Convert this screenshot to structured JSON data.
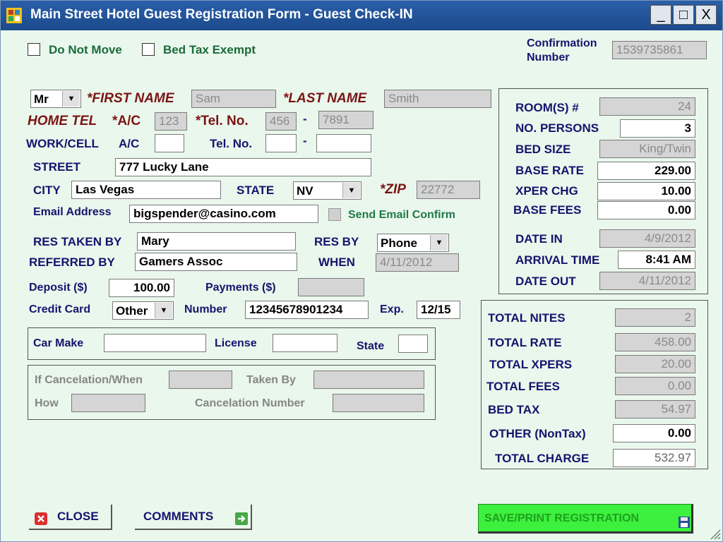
{
  "window": {
    "title": "Main Street Hotel Guest Registration Form - Guest Check-IN",
    "minimize": "_",
    "maximize": "□",
    "close": "X"
  },
  "top": {
    "do_not_move": "Do Not Move",
    "bed_tax_exempt": "Bed Tax Exempt",
    "confirmation_label_1": "Confirmation",
    "confirmation_label_2": "Number",
    "confirmation_value": "1539735861"
  },
  "guest": {
    "title": "Mr",
    "first_name_label": "*FIRST NAME",
    "first_name": "Sam",
    "last_name_label": "*LAST NAME",
    "last_name": "Smith",
    "home_tel_label": "HOME TEL",
    "ac_label_req": "*A/C",
    "home_ac": "123",
    "tel_label_req": "*Tel. No.",
    "home_tel_1": "456",
    "dash": "-",
    "home_tel_2": "7891",
    "work_label": "WORK/CELL",
    "ac_label": "A/C",
    "work_ac": "",
    "tel_label": "Tel. No.",
    "work_tel_1": "",
    "work_tel_2": "",
    "street_label": "STREET",
    "street": "777 Lucky Lane",
    "city_label": "CITY",
    "city": "Las Vegas",
    "state_label": "STATE",
    "state": "NV",
    "zip_label": "*ZIP",
    "zip": "22772",
    "email_label": "Email Address",
    "email": "bigspender@casino.com",
    "send_email": "Send Email Confirm"
  },
  "reservation": {
    "res_taken_by_label": "RES TAKEN BY",
    "res_taken_by": "Mary",
    "res_by_label": "RES BY",
    "res_by": "Phone",
    "referred_by_label": "REFERRED BY",
    "referred_by": "Gamers Assoc",
    "when_label": "WHEN",
    "when": "4/11/2012",
    "deposit_label": "Deposit ($)",
    "deposit": "100.00",
    "payments_label": "Payments ($)",
    "payments": "",
    "credit_card_label": "Credit Card",
    "credit_card": "Other",
    "number_label": "Number",
    "number": "12345678901234",
    "exp_label": "Exp.",
    "exp": "12/15"
  },
  "car": {
    "make_label": "Car Make",
    "make": "",
    "license_label": "License",
    "license": "",
    "state_label": "State",
    "state": ""
  },
  "cancel": {
    "when_label": "If Cancelation/When",
    "when": "",
    "taken_by_label": "Taken By",
    "taken_by": "",
    "how_label": "How",
    "how": "",
    "number_label": "Cancelation Number",
    "number": ""
  },
  "room": {
    "rooms_label": "ROOM(S) #",
    "rooms": "24",
    "persons_label": "NO. PERSONS",
    "persons": "3",
    "bed_size_label": "BED SIZE",
    "bed_size": "King/Twin",
    "base_rate_label": "BASE RATE",
    "base_rate": "229.00",
    "xper_label": "XPER CHG",
    "xper": "10.00",
    "base_fees_label": "BASE FEES",
    "base_fees": "0.00",
    "date_in_label": "DATE IN",
    "date_in": "4/9/2012",
    "arrival_label": "ARRIVAL TIME",
    "arrival": "8:41 AM",
    "date_out_label": "DATE OUT",
    "date_out": "4/11/2012"
  },
  "totals": {
    "nites_label": "TOTAL NITES",
    "nites": "2",
    "rate_label": "TOTAL RATE",
    "rate": "458.00",
    "xpers_label": "TOTAL XPERS",
    "xpers": "20.00",
    "fees_label": "TOTAL FEES",
    "fees": "0.00",
    "bed_tax_label": "BED TAX",
    "bed_tax": "54.97",
    "other_label": "OTHER (NonTax)",
    "other": "0.00",
    "charge_label": "TOTAL CHARGE",
    "charge": "532.97"
  },
  "buttons": {
    "close": "CLOSE",
    "comments": "COMMENTS",
    "save_print": "SAVE/PRINT REGISTRATION"
  },
  "colors": {
    "save_button": "#3df03d",
    "titlebar": "#1f4f96",
    "form_background": "#eaf7ec"
  }
}
